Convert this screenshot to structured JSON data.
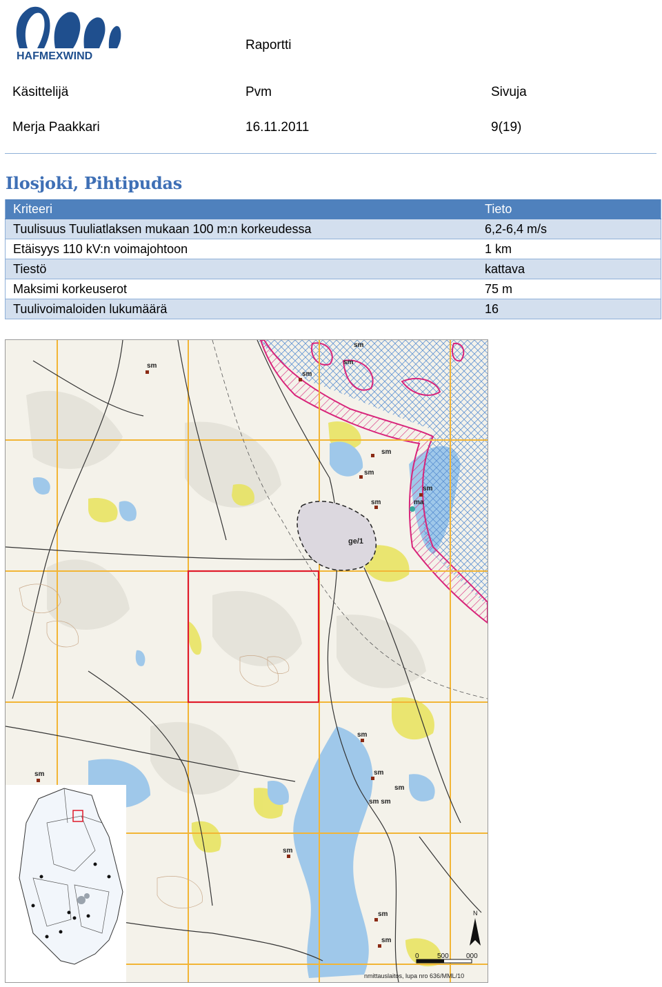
{
  "header": {
    "logo_text": "HAFMEXWIND",
    "report_label": "Raportti",
    "handler_label": "Käsittelijä",
    "date_label": "Pvm",
    "pages_label": "Sivuja",
    "handler_value": "Merja Paakkari",
    "date_value": "16.11.2011",
    "pages_value": "9(19)"
  },
  "site_title": "Ilosjoki, Pihtipudas",
  "table": {
    "col_criteria": "Kriteeri",
    "col_value": "Tieto",
    "rows": [
      {
        "criterion": "Tuulisuus Tuuliatlaksen mukaan 100 m:n korkeudessa",
        "value": "6,2-6,4 m/s"
      },
      {
        "criterion": "Etäisyys 110 kV:n voimajohtoon",
        "value": "1 km"
      },
      {
        "criterion": "Tiestö",
        "value": "kattava"
      },
      {
        "criterion": "Maksimi korkeuserot",
        "value": "75 m"
      },
      {
        "criterion": "Tuulivoimaloiden lukumäärä",
        "value": "16"
      }
    ]
  },
  "map": {
    "place_labels": {
      "sm": "sm",
      "ma": "ma",
      "ge": "ge/1",
      "smsm": "sm sm"
    },
    "scale": {
      "zero": "0",
      "mid": "500",
      "end": "000"
    },
    "north": "N",
    "credit": "nmittauslaitos, lupa nro 636/MML/10",
    "colors": {
      "grid": "#f2b535",
      "site": "#e01a2a",
      "water": "#9fc8ea",
      "bog": "#e5e3da",
      "field": "#e8e35a",
      "protected": "#d8247a"
    }
  }
}
